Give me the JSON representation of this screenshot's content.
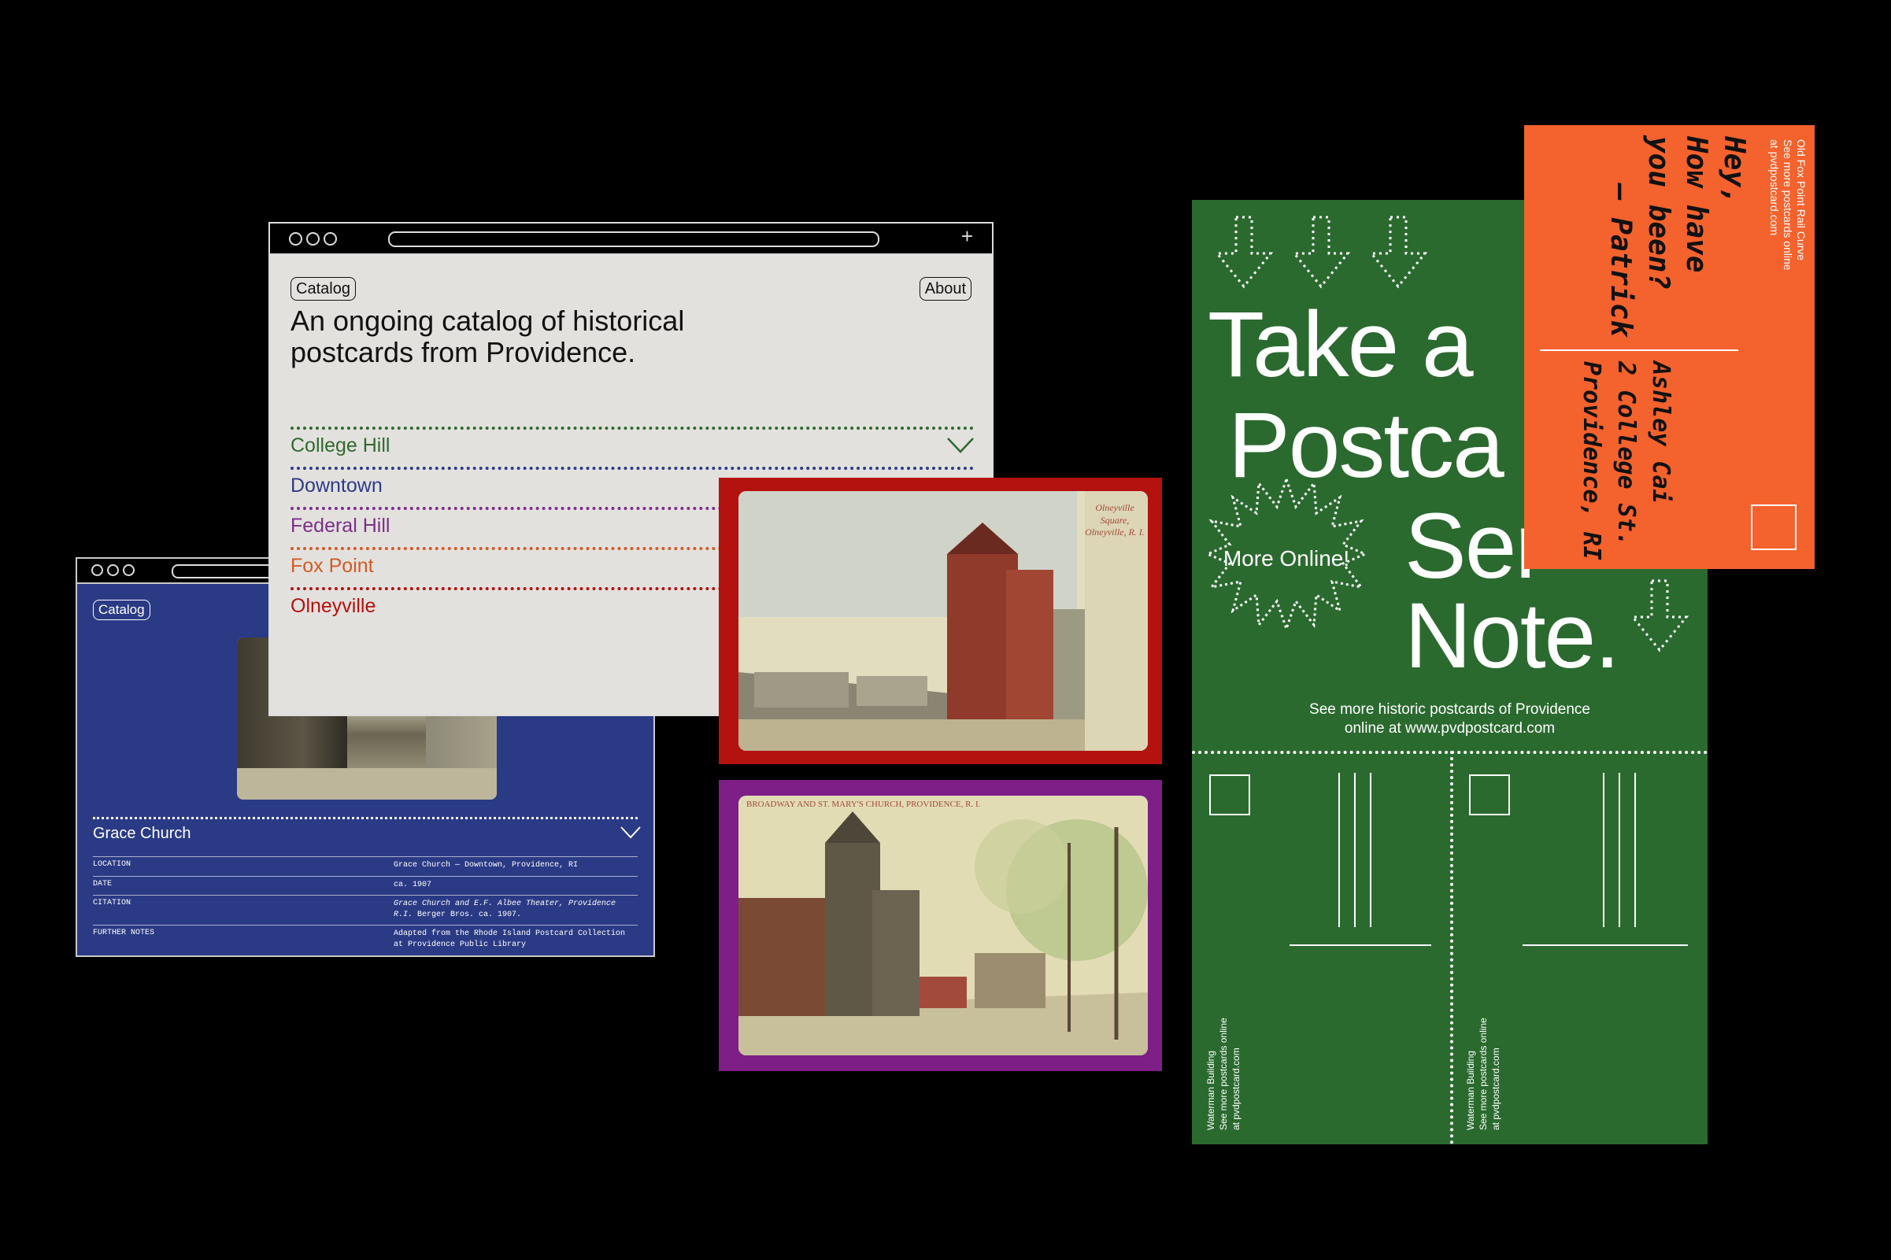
{
  "catalog_window": {
    "catalog_button": "Catalog",
    "about_button": "About",
    "title": "An ongoing catalog of historical postcards from Providence.",
    "categories": [
      {
        "label": "College Hill",
        "color": "#2f6a2e"
      },
      {
        "label": "Downtown",
        "color": "#2e3a86"
      },
      {
        "label": "Federal Hill",
        "color": "#7b2f88"
      },
      {
        "label": "Fox Point",
        "color": "#d35a24"
      },
      {
        "label": "Olneyville",
        "color": "#b3120f"
      }
    ]
  },
  "detail_window": {
    "catalog_button": "Catalog",
    "entry_title": "Grace Church",
    "rows": [
      {
        "key": "LOCATION",
        "value": "Grace Church — Downtown, Providence, RI"
      },
      {
        "key": "DATE",
        "value": "ca. 1907"
      },
      {
        "key": "CITATION",
        "value_italic": "Grace Church and E.F. Albee Theater, Providence R.I.",
        "value": " Berger Bros. ca. 1907."
      },
      {
        "key": "FURTHER NOTES",
        "value": "Adapted from the Rhode Island Postcard Collection at Providence Public Library"
      }
    ]
  },
  "postcards": {
    "red_caption": "Olneyville Square, Olneyville, R. I.",
    "purple_caption": "BROADWAY AND ST. MARY'S CHURCH, PROVIDENCE, R. I."
  },
  "green_card": {
    "headline_lines": [
      "Take a",
      "Postca",
      "Ser",
      "Note."
    ],
    "badge": "More Online!",
    "footer_line1": "See more historic postcards of Providence",
    "footer_line2": "online at www.pvdpostcard.com",
    "side_text_line1": "Waterman Building",
    "side_text_line2": "See more postcards online",
    "side_text_line3": "at pvdpostcard.com"
  },
  "orange_card": {
    "title": "Old Fox Point Rail Curve",
    "line2": "See more postcards online",
    "line3": "at pvdpostcard.com",
    "message": [
      "Hey,",
      "How have",
      "you been?",
      "– Patrick"
    ],
    "address": [
      "Ashley Cai",
      "2 College St.",
      "Providence, RI"
    ]
  },
  "colors": {
    "background": "#000000",
    "blue_window": "#2b3a85",
    "gray_window": "#e3e1de",
    "green_card": "#2b6a2f",
    "orange_card": "#f4622d",
    "red_frame": "#b3120f",
    "purple_frame": "#7d1f86"
  }
}
